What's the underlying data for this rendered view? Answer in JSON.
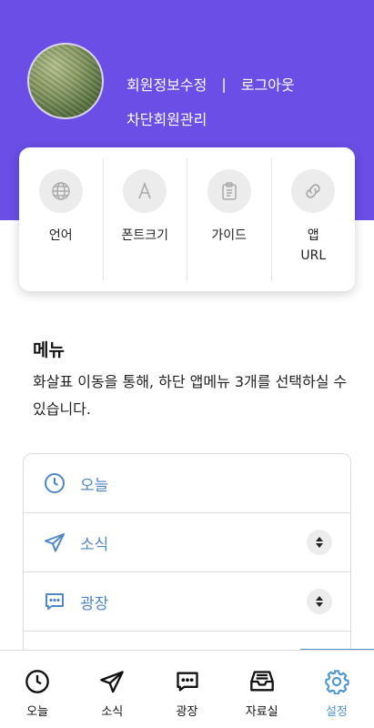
{
  "header": {
    "edit_profile": "회원정보수정",
    "separator": "|",
    "logout": "로그아웃",
    "block_management": "차단회원관리"
  },
  "quick_menu": [
    {
      "label": "언어",
      "icon": "globe-icon"
    },
    {
      "label": "폰트크기",
      "icon": "font-a-icon"
    },
    {
      "label": "가이드",
      "icon": "clipboard-icon"
    },
    {
      "label": "앱\nURL",
      "icon": "link-icon"
    }
  ],
  "menu": {
    "title": "메뉴",
    "description": "화살표 이동을 통해, 하단 앱메뉴 3개를 선택하실 수 있습니다.",
    "items": [
      {
        "label": "오늘",
        "icon": "clock-icon",
        "sortable": false
      },
      {
        "label": "소식",
        "icon": "paper-plane-icon",
        "sortable": true
      },
      {
        "label": "광장",
        "icon": "chat-bubble-icon",
        "sortable": true
      }
    ]
  },
  "tabbar": {
    "items": [
      {
        "label": "오늘",
        "icon": "clock-icon"
      },
      {
        "label": "소식",
        "icon": "paper-plane-icon"
      },
      {
        "label": "광장",
        "icon": "chat-bubble-icon"
      },
      {
        "label": "자료실",
        "icon": "archive-tray-icon"
      },
      {
        "label": "설정",
        "icon": "gear-icon"
      }
    ],
    "active_index": 4
  },
  "colors": {
    "header_bg": "#6a4ee6",
    "accent_blue": "#4f95d0",
    "menu_text": "#4e86c6"
  }
}
